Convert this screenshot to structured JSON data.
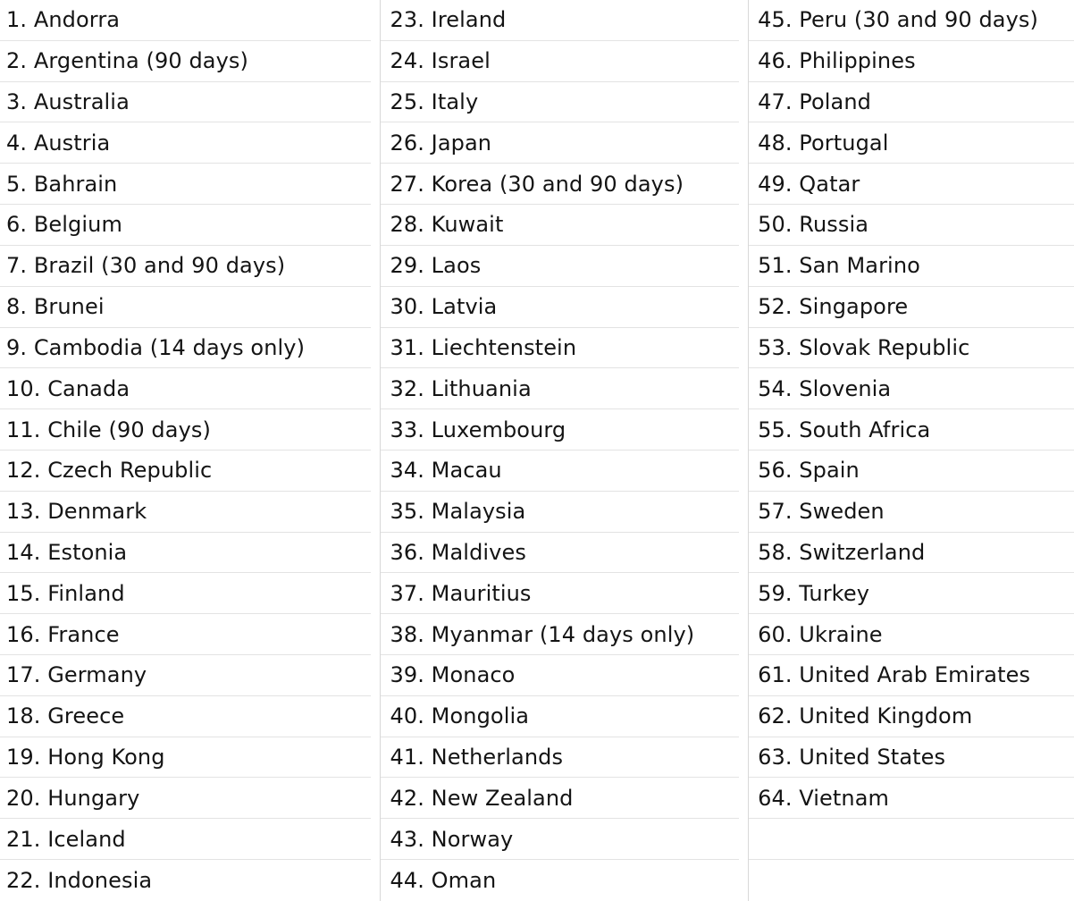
{
  "table": {
    "columns": [
      {
        "name": "column-1",
        "items": [
          "1. Andorra",
          "2. Argentina (90 days)",
          "3. Australia",
          "4. Austria",
          "5. Bahrain",
          "6. Belgium",
          "7. Brazil (30 and 90 days)",
          "8. Brunei",
          "9. Cambodia (14 days only)",
          "10. Canada",
          "11. Chile (90 days)",
          "12. Czech Republic",
          "13. Denmark",
          "14. Estonia",
          "15. Finland",
          "16. France",
          "17. Germany",
          "18. Greece",
          "19. Hong Kong",
          "20. Hungary",
          "21. Iceland",
          "22. Indonesia"
        ]
      },
      {
        "name": "column-2",
        "items": [
          "23. Ireland",
          "24. Israel",
          "25. Italy",
          "26. Japan",
          "27. Korea (30 and 90 days)",
          "28. Kuwait",
          "29. Laos",
          "30. Latvia",
          "31. Liechtenstein",
          "32. Lithuania",
          "33. Luxembourg",
          "34. Macau",
          "35. Malaysia",
          "36. Maldives",
          "37. Mauritius",
          "38. Myanmar (14 days only)",
          "39. Monaco",
          "40. Mongolia",
          "41. Netherlands",
          "42. New Zealand",
          "43. Norway",
          "44. Oman"
        ]
      },
      {
        "name": "column-3",
        "items": [
          "45. Peru (30 and 90 days)",
          "46. Philippines",
          "47. Poland",
          "48. Portugal",
          "49. Qatar",
          "50. Russia",
          "51. San Marino",
          "52. Singapore",
          "53. Slovak Republic",
          "54. Slovenia",
          "55. South Africa",
          "56. Spain",
          "57. Sweden",
          "58. Switzerland",
          "59. Turkey",
          "60. Ukraine",
          "61. United Arab Emirates",
          "62. United Kingdom",
          "63. United States",
          "64. Vietnam",
          "",
          ""
        ]
      }
    ]
  },
  "colors": {
    "background": "#ffffff",
    "text": "#141414",
    "row_border": "#e3e3e3",
    "column_border": "#d8d8d8"
  }
}
